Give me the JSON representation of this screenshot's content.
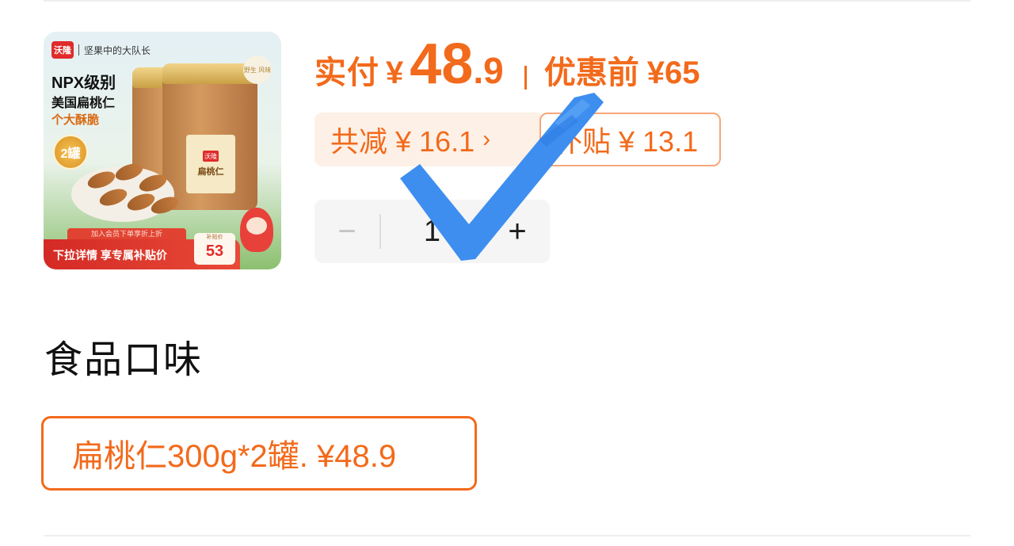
{
  "product_image": {
    "brand_logo": "沃隆",
    "brand_slogan": "坚果中的大队长",
    "promo_title": "NPX级别",
    "promo_subtitle": "美国扁桃仁",
    "promo_tagline": "个大酥脆",
    "cans_badge": "2罐",
    "jar_logo": "沃隆",
    "jar_name": "扁桃仁",
    "flavor_tag": "野生\n风味",
    "banner_top": "加入会员下单享折上折",
    "banner_text": "下拉详情 享专属补贴价",
    "banner_price_label": "补贴价",
    "banner_price": "53"
  },
  "price": {
    "paid_label": "实付",
    "currency": "¥",
    "price_integer": "48",
    "price_decimal": ".9",
    "before_label": "优惠前",
    "original_price": "¥65"
  },
  "discounts": {
    "total_reduction": "共减 ¥ 16.1",
    "arrow": "›",
    "subsidy": "补贴 ¥ 13.1"
  },
  "quantity": {
    "minus": "−",
    "value": "1",
    "plus": "+"
  },
  "flavor_section": {
    "title": "食品口味",
    "options": [
      {
        "label": "扁桃仁300g*2罐. ¥48.9",
        "selected": true
      }
    ]
  },
  "colors": {
    "accent": "#f26a1b",
    "checkmark": "#3e8ef0"
  },
  "overlay_icon": "checkmark-icon"
}
